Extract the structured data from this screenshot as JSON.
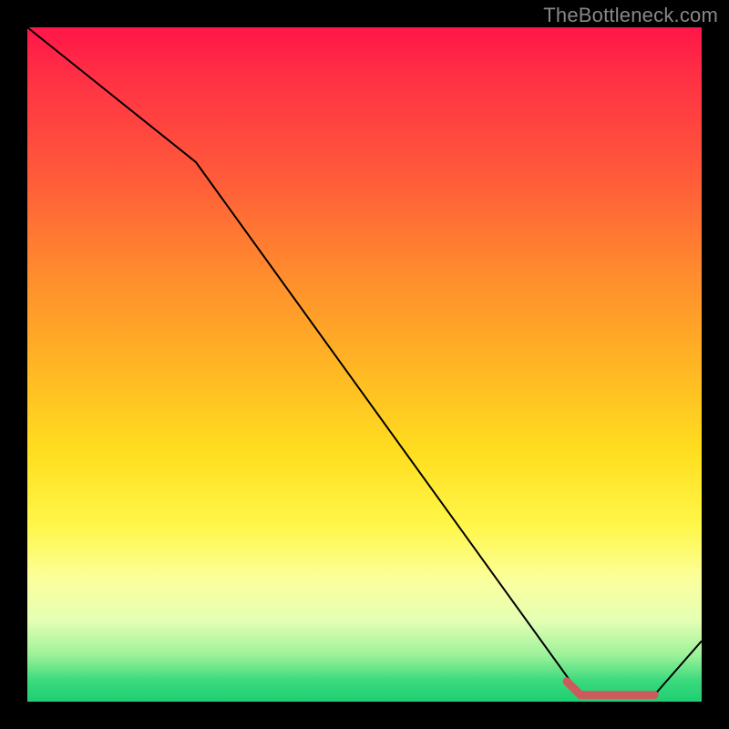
{
  "watermark": "TheBottleneck.com",
  "chart_data": {
    "type": "line",
    "title": "",
    "xlabel": "",
    "ylabel": "",
    "xlim": [
      0,
      100
    ],
    "ylim": [
      0,
      100
    ],
    "grid": false,
    "legend": false,
    "series": [
      {
        "name": "black-line",
        "color": "#000000",
        "points": [
          {
            "x": 0,
            "y": 100
          },
          {
            "x": 25,
            "y": 80
          },
          {
            "x": 82,
            "y": 1
          },
          {
            "x": 93,
            "y": 1
          },
          {
            "x": 100,
            "y": 9
          }
        ]
      }
    ],
    "highlight": {
      "name": "bottleneck-region",
      "color": "#cc5c5c",
      "points": [
        {
          "x": 80,
          "y": 3
        },
        {
          "x": 82,
          "y": 1
        },
        {
          "x": 93,
          "y": 1
        }
      ]
    }
  }
}
